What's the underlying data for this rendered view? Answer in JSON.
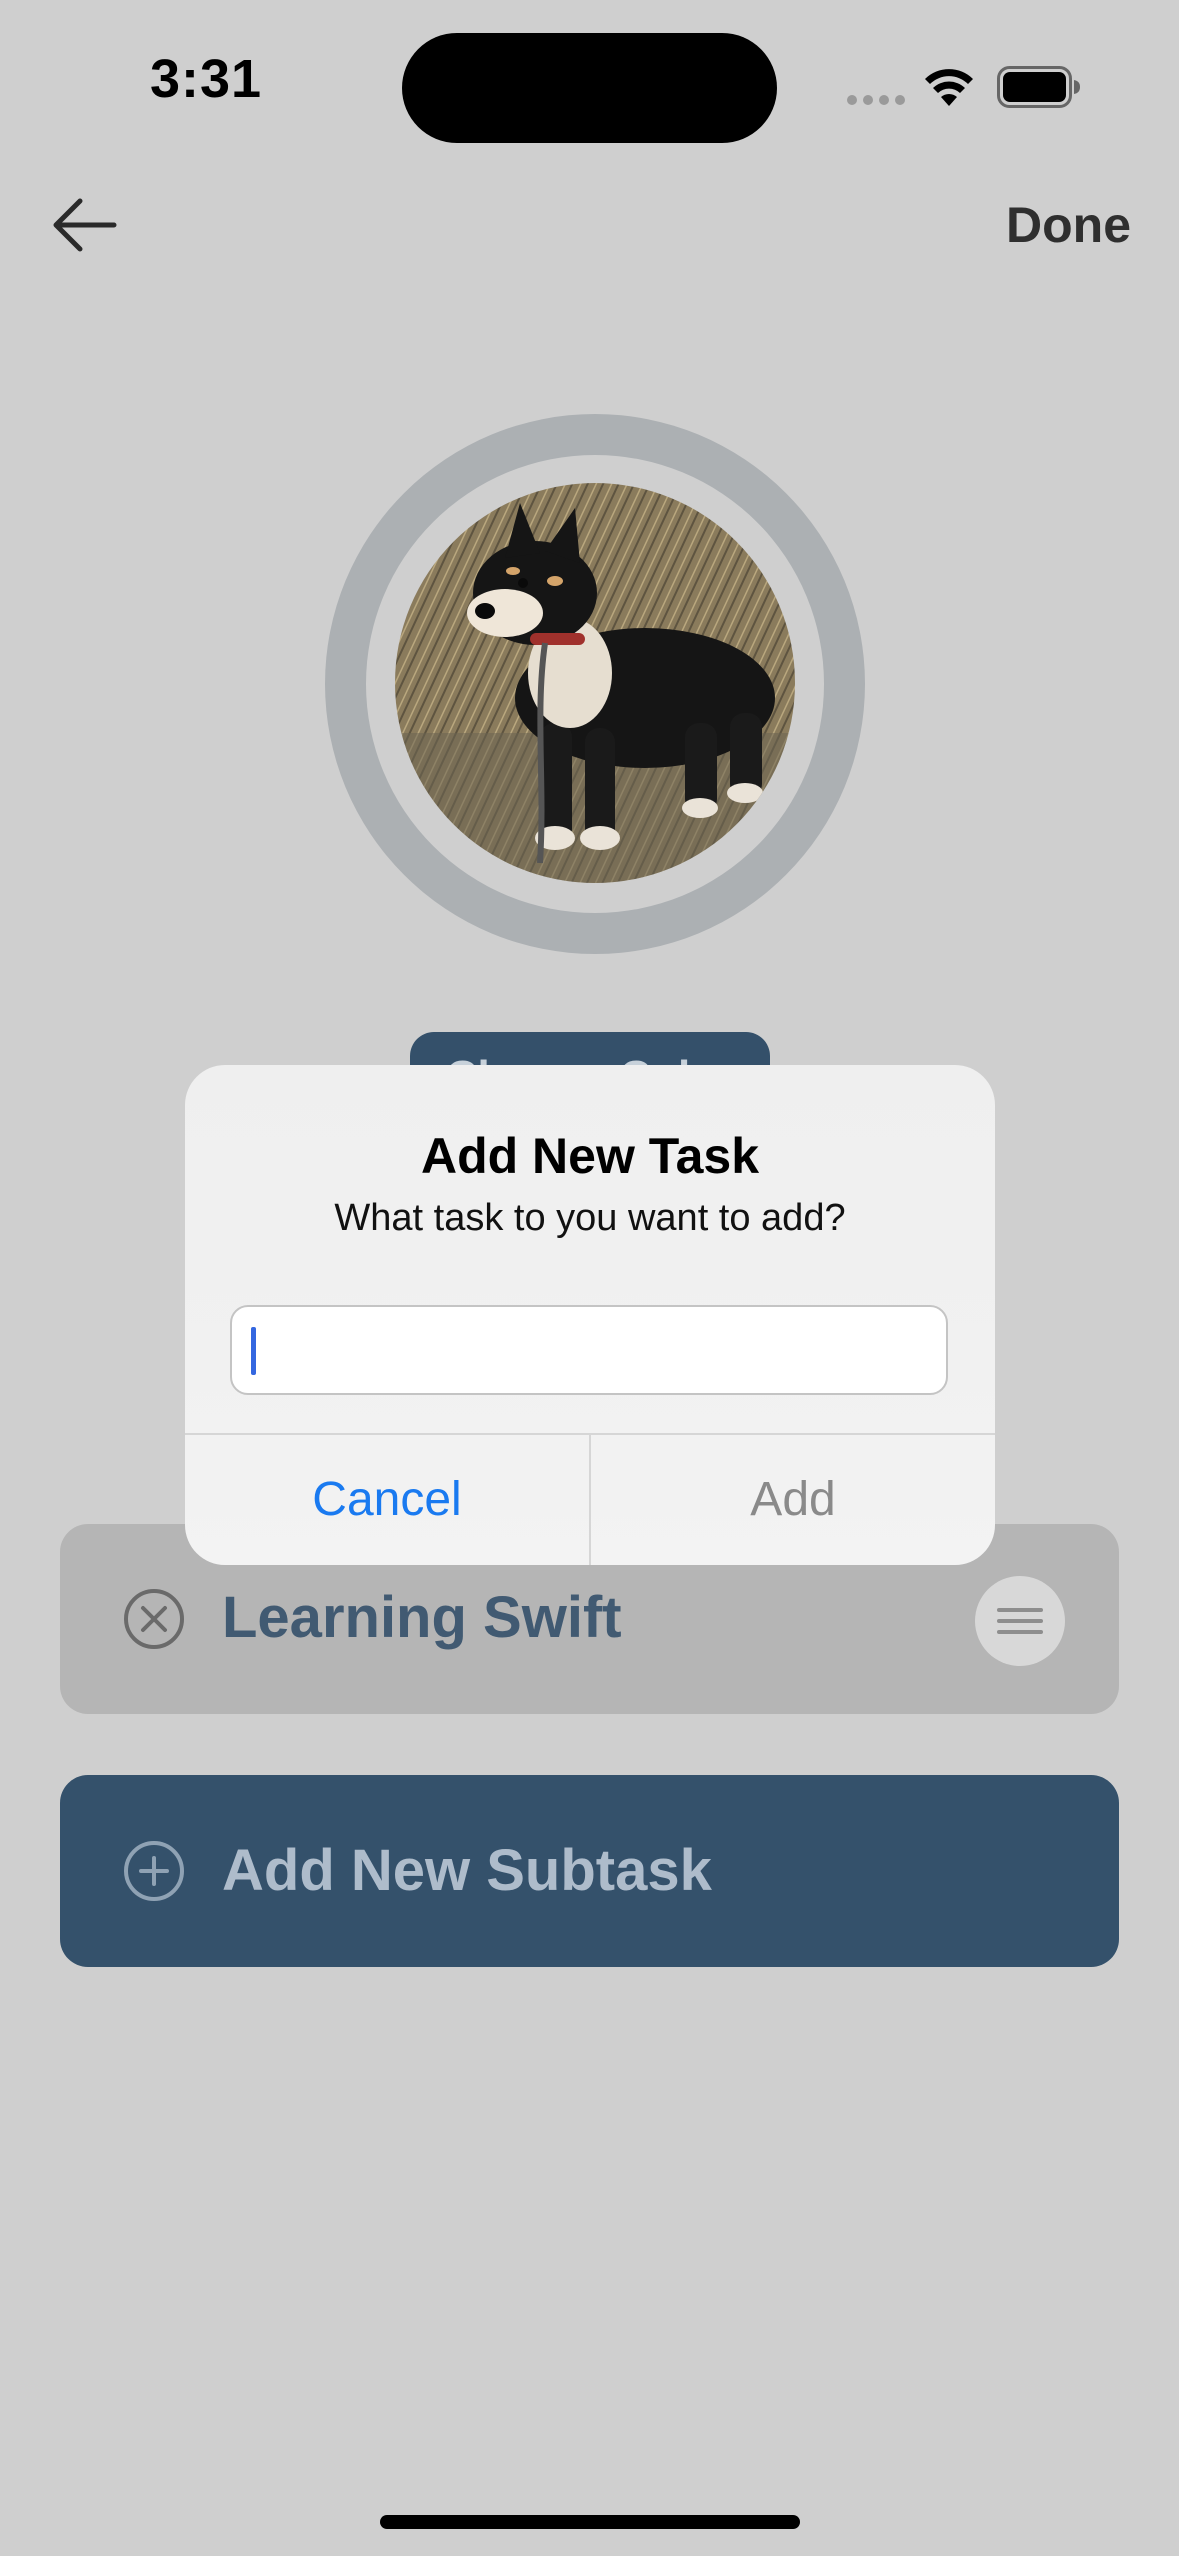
{
  "status_bar": {
    "time": "3:31",
    "icons": [
      "signal-dots-icon",
      "wifi-icon",
      "battery-icon"
    ]
  },
  "nav": {
    "back_icon": "arrow-left-icon",
    "done_label": "Done"
  },
  "avatar": {
    "description_icon": "dog-photo"
  },
  "change_color": {
    "label": "Change Color"
  },
  "subtasks": [
    {
      "label": "Learning Swift"
    }
  ],
  "add_subtask": {
    "label": "Add New Subtask"
  },
  "alert": {
    "title": "Add New Task",
    "message": "What task to you want to add?",
    "input_value": "",
    "input_placeholder": "",
    "cancel_label": "Cancel",
    "add_label": "Add"
  },
  "colors": {
    "background": "#cfcfcf",
    "accent_blue": "#1a7af0",
    "primary_dark": "#34516b",
    "ring_gray": "#acb0b3"
  }
}
